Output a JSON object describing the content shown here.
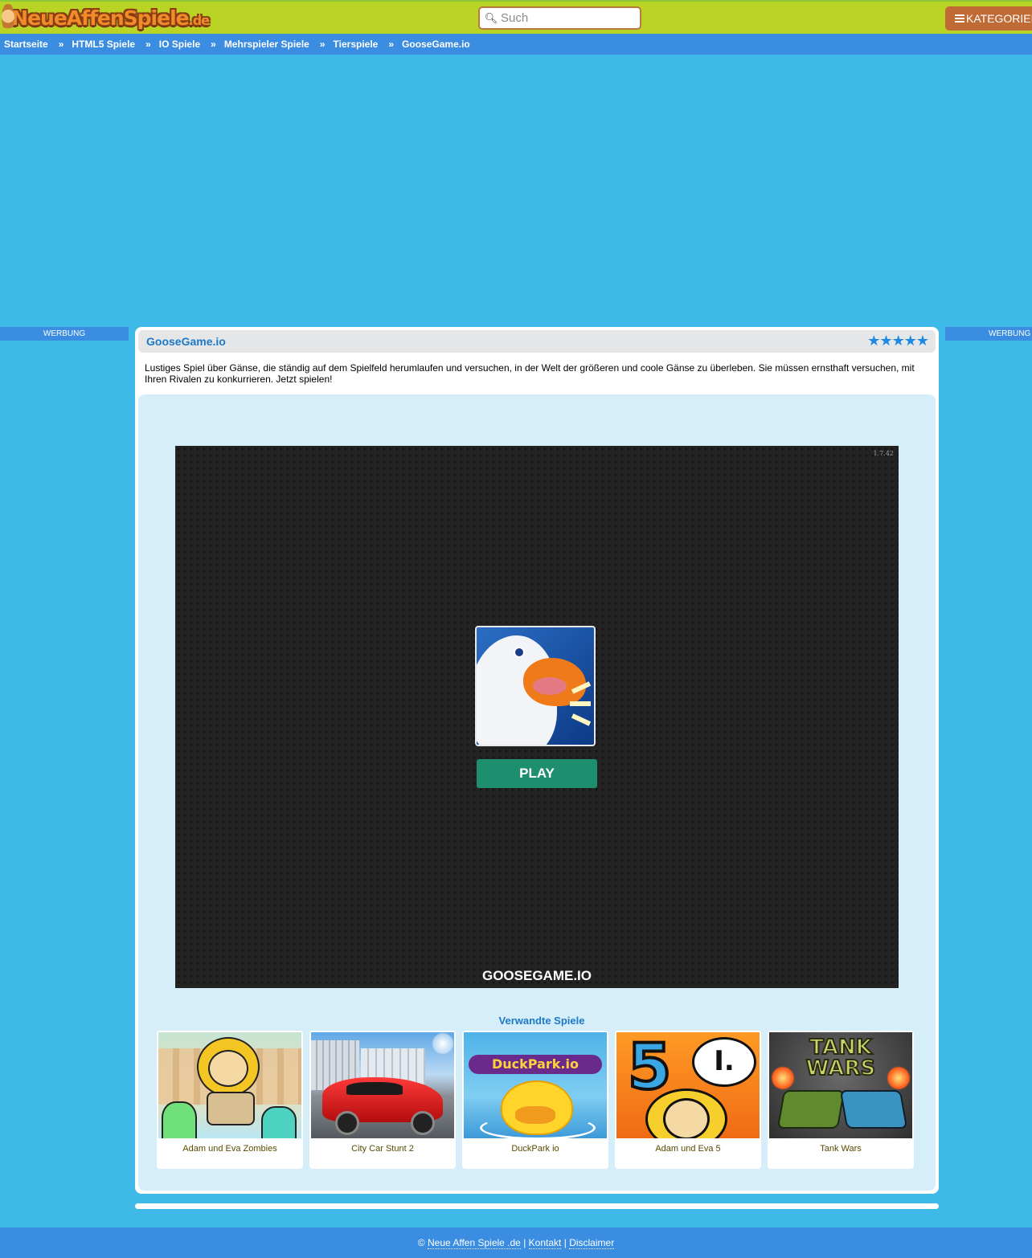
{
  "header": {
    "logo_text": "NeueAffenSpiele",
    "logo_tld": ".de",
    "search_placeholder": "Such",
    "categories_label": "KATEGORIEN",
    "accent_color": "#b9d425"
  },
  "breadcrumb": {
    "separator": "»",
    "items": [
      "Startseite",
      "HTML5 Spiele",
      "IO Spiele",
      "Mehrspieler Spiele",
      "Tierspiele",
      "GooseGame.io"
    ]
  },
  "ads": {
    "left_label": "WERBUNG",
    "right_label": "WERBUNG"
  },
  "game": {
    "title": "GooseGame.io",
    "rating": 5,
    "rating_max": 5,
    "description": "Lustiges Spiel über Gänse, die ständig auf dem Spielfeld herumlaufen und versuchen, in der Welt der größeren und coole Gänse zu überleben. Sie müssen ernsthaft versuchen, mit Ihren Rivalen zu konkurrieren. Jetzt spielen!",
    "version": "1.7.42",
    "play_label": "PLAY",
    "name_caption": "GOOSEGAME.IO"
  },
  "related": {
    "title": "Verwandte Spiele",
    "items": [
      {
        "label": "Adam und Eva Zombies",
        "icon": "adam-eva-zombies-thumb"
      },
      {
        "label": "City Car Stunt 2",
        "icon": "city-car-stunt-thumb"
      },
      {
        "label": "DuckPark io",
        "icon": "duckpark-thumb",
        "thumb_text": "DuckPark.io"
      },
      {
        "label": "Adam und Eva 5",
        "icon": "adam-eva-5-thumb",
        "thumb_text": "5",
        "thumb_text2": "I."
      },
      {
        "label": "Tank Wars",
        "icon": "tank-wars-thumb",
        "thumb_text": "TANK",
        "thumb_text2": "WARS"
      }
    ]
  },
  "footer": {
    "copyright": "©",
    "site_link": "Neue Affen Spiele .de",
    "divider": "|",
    "contact": "Kontakt",
    "disclaimer": "Disclaimer"
  }
}
